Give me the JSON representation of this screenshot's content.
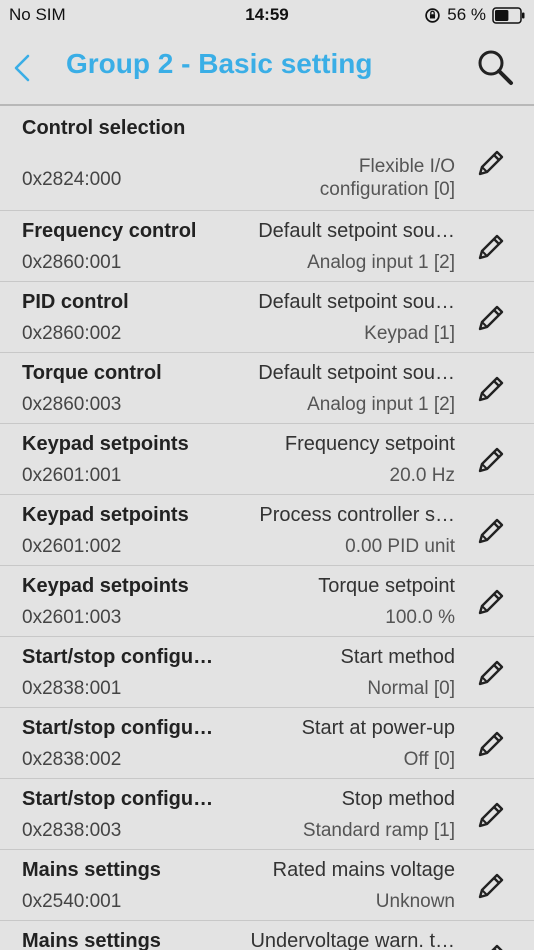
{
  "status_bar": {
    "carrier": "No SIM",
    "time": "14:59",
    "battery_percent": "56 %",
    "battery_level": 0.56
  },
  "header": {
    "title": "Group 2 - Basic setting",
    "back_icon": "chevron-left-icon",
    "search_icon": "search-icon"
  },
  "colors": {
    "accent": "#3aaee6",
    "background": "#e3e3e3"
  },
  "parameters": [
    {
      "name": "Control selection",
      "index": "0x2824:000",
      "title": "",
      "value": "Flexible I/O configuration [0]"
    },
    {
      "name": "Frequency control",
      "index": "0x2860:001",
      "title": "Default setpoint sou…",
      "value": "Analog input 1 [2]"
    },
    {
      "name": "PID control",
      "index": "0x2860:002",
      "title": "Default setpoint sou…",
      "value": "Keypad [1]"
    },
    {
      "name": "Torque control",
      "index": "0x2860:003",
      "title": "Default setpoint sou…",
      "value": "Analog input 1 [2]"
    },
    {
      "name": "Keypad setpoints",
      "index": "0x2601:001",
      "title": "Frequency setpoint",
      "value": "20.0 Hz"
    },
    {
      "name": "Keypad setpoints",
      "index": "0x2601:002",
      "title": "Process controller s…",
      "value": "0.00 PID unit"
    },
    {
      "name": "Keypad setpoints",
      "index": "0x2601:003",
      "title": "Torque setpoint",
      "value": "100.0 %"
    },
    {
      "name": "Start/stop configu…",
      "index": "0x2838:001",
      "title": "Start method",
      "value": "Normal [0]"
    },
    {
      "name": "Start/stop configu…",
      "index": "0x2838:002",
      "title": "Start at power-up",
      "value": "Off [0]"
    },
    {
      "name": "Start/stop configu…",
      "index": "0x2838:003",
      "title": "Stop method",
      "value": "Standard ramp [1]"
    },
    {
      "name": "Mains settings",
      "index": "0x2540:001",
      "title": "Rated mains voltage",
      "value": "Unknown"
    },
    {
      "name": "Mains settings",
      "index": "",
      "title": "Undervoltage warn. t…",
      "value": ""
    }
  ]
}
